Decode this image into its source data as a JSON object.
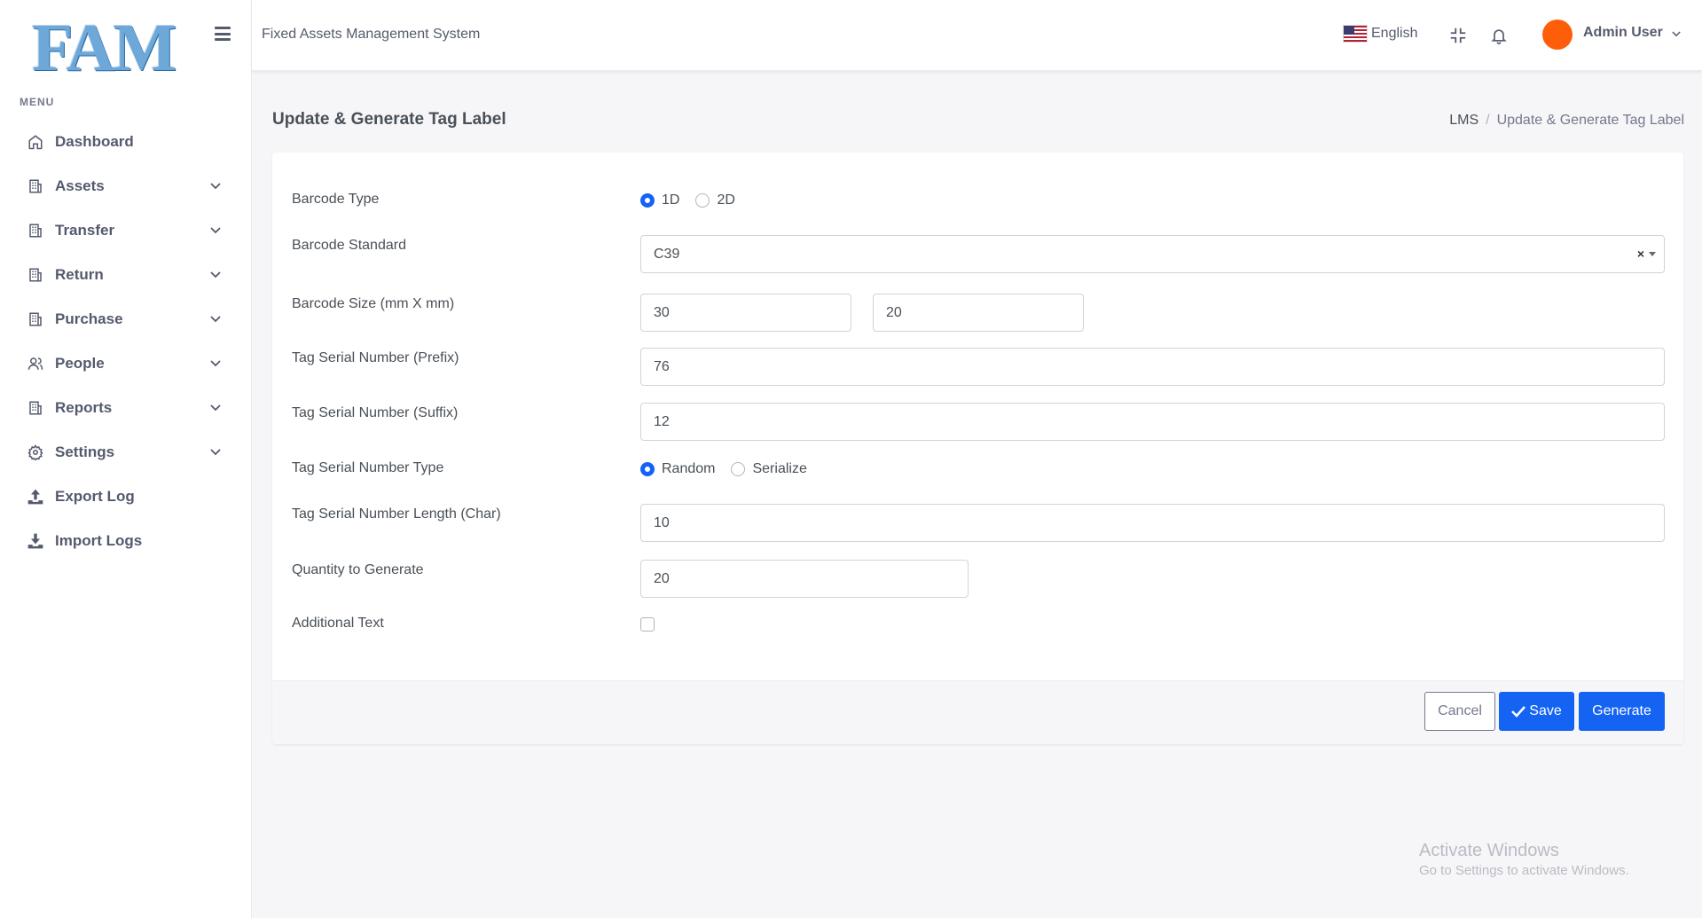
{
  "brand": {
    "logo_text": "FAM"
  },
  "sidebar": {
    "menu_title": "MENU",
    "items": [
      {
        "label": "Dashboard",
        "icon": "home-icon",
        "has_children": false
      },
      {
        "label": "Assets",
        "icon": "building-icon",
        "has_children": true
      },
      {
        "label": "Transfer",
        "icon": "building-icon",
        "has_children": true
      },
      {
        "label": "Return",
        "icon": "building-icon",
        "has_children": true
      },
      {
        "label": "Purchase",
        "icon": "building-icon",
        "has_children": true
      },
      {
        "label": "People",
        "icon": "users-icon",
        "has_children": true
      },
      {
        "label": "Reports",
        "icon": "building-icon",
        "has_children": true
      },
      {
        "label": "Settings",
        "icon": "gear-icon",
        "has_children": true
      },
      {
        "label": "Export Log",
        "icon": "upload-icon",
        "has_children": false
      },
      {
        "label": "Import Logs",
        "icon": "download-icon",
        "has_children": false
      }
    ]
  },
  "header": {
    "app_title": "Fixed Assets Management System",
    "language": "English",
    "user_name": "Admin User",
    "avatar_color": "#fe5e0a"
  },
  "page": {
    "title": "Update & Generate Tag Label",
    "breadcrumb": [
      "LMS",
      "Update & Generate Tag Label"
    ]
  },
  "form": {
    "barcode_type": {
      "label": "Barcode Type",
      "options": [
        "1D",
        "2D"
      ],
      "selected": "1D"
    },
    "barcode_standard": {
      "label": "Barcode Standard",
      "value": "C39"
    },
    "barcode_size": {
      "label": "Barcode Size (mm X mm)",
      "width": "30",
      "height": "20"
    },
    "tag_prefix": {
      "label": "Tag Serial Number (Prefix)",
      "value": "76"
    },
    "tag_suffix": {
      "label": "Tag Serial Number (Suffix)",
      "value": "12"
    },
    "tag_type": {
      "label": "Tag Serial Number Type",
      "options": [
        "Random",
        "Serialize"
      ],
      "selected": "Random"
    },
    "tag_length": {
      "label": "Tag Serial Number Length (Char)",
      "value": "10"
    },
    "quantity": {
      "label": "Quantity to Generate",
      "value": "20"
    },
    "additional_text": {
      "label": "Additional Text",
      "checked": false
    }
  },
  "actions": {
    "cancel": "Cancel",
    "save": "Save",
    "generate": "Generate"
  },
  "colors": {
    "primary": "#1463f3",
    "logo": "#6ea8d8"
  },
  "watermark": {
    "title": "Activate Windows",
    "subtitle": "Go to Settings to activate Windows."
  }
}
